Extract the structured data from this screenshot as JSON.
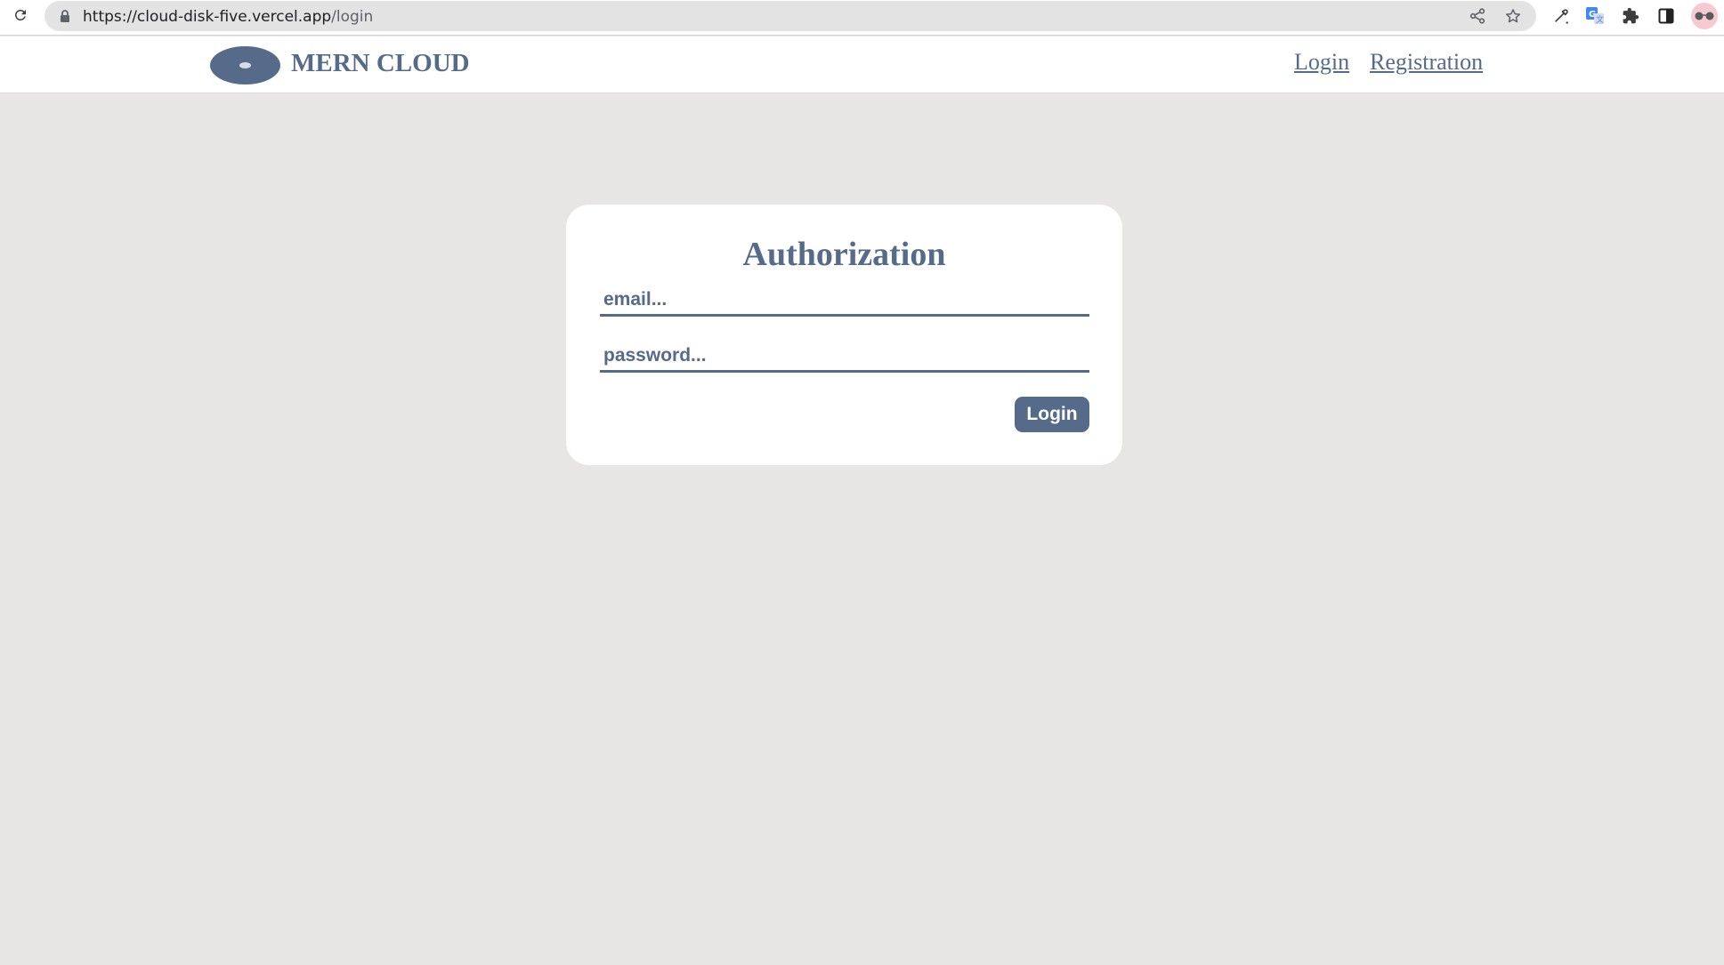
{
  "browser": {
    "url_host": "https://cloud-disk-five.vercel.app",
    "url_path": "/login",
    "icons": {
      "reload": "reload-icon",
      "lock": "lock-icon",
      "share": "share-icon",
      "bookmark": "star-icon",
      "eyedropper": "eyedropper-icon",
      "translate": "translate-icon",
      "extensions": "puzzle-icon",
      "side_panel": "side-panel-icon",
      "profile": "profile-avatar"
    }
  },
  "header": {
    "logo_text": "MERN CLOUD",
    "nav": {
      "login": "Login",
      "registration": "Registration"
    }
  },
  "auth": {
    "title": "Authorization",
    "email": {
      "value": "",
      "placeholder": "email..."
    },
    "password": {
      "value": "",
      "placeholder": "password..."
    },
    "submit_label": "Login"
  },
  "colors": {
    "accent": "#566a8a",
    "page_background": "#e7e6e4",
    "card_background": "#ffffff"
  }
}
